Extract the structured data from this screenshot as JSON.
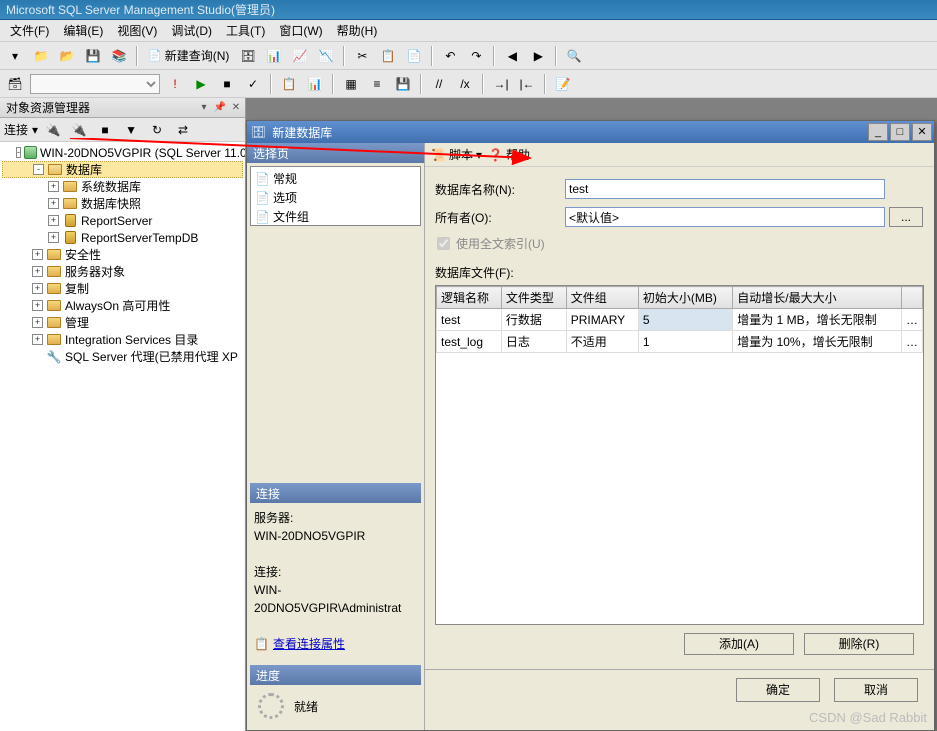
{
  "app_title": "Microsoft SQL Server Management Studio(管理员)",
  "menu": [
    "文件(F)",
    "编辑(E)",
    "视图(V)",
    "调试(D)",
    "工具(T)",
    "窗口(W)",
    "帮助(H)"
  ],
  "toolbar": {
    "new_query": "新建查询(N)"
  },
  "explorer": {
    "title": "对象资源管理器",
    "connect": "连接",
    "server": "WIN-20DNO5VGPIR (SQL Server 11.0",
    "nodes": {
      "databases": "数据库",
      "sys_db": "系统数据库",
      "db_snapshot": "数据库快照",
      "report_server": "ReportServer",
      "report_server_tmp": "ReportServerTempDB",
      "security": "安全性",
      "server_objects": "服务器对象",
      "replication": "复制",
      "alwayson": "AlwaysOn 高可用性",
      "management": "管理",
      "integration": "Integration Services 目录",
      "agent": "SQL Server 代理(已禁用代理 XP"
    }
  },
  "dialog": {
    "title": "新建数据库",
    "select_page": "选择页",
    "pages": [
      "常规",
      "选项",
      "文件组"
    ],
    "script": "脚本",
    "help": "帮助",
    "db_name_label": "数据库名称(N):",
    "db_name_value": "test",
    "owner_label": "所有者(O):",
    "owner_value": "<默认值>",
    "fulltext": "使用全文索引(U)",
    "files_label": "数据库文件(F):",
    "grid": {
      "headers": [
        "逻辑名称",
        "文件类型",
        "文件组",
        "初始大小(MB)",
        "自动增长/最大大小"
      ],
      "rows": [
        {
          "name": "test",
          "ftype": "行数据",
          "fgroup": "PRIMARY",
          "size": "5",
          "growth": "增量为 1 MB，增长无限制"
        },
        {
          "name": "test_log",
          "ftype": "日志",
          "fgroup": "不适用",
          "size": "1",
          "growth": "增量为 10%，增长无限制"
        }
      ]
    },
    "add_btn": "添加(A)",
    "del_btn": "删除(R)",
    "connection_hdr": "连接",
    "server_lbl": "服务器:",
    "server_val": "WIN-20DNO5VGPIR",
    "conn_lbl": "连接:",
    "conn_val": "WIN-20DNO5VGPIR\\Administrat",
    "view_conn": "查看连接属性",
    "progress_hdr": "进度",
    "ready": "就绪",
    "ok": "确定",
    "cancel": "取消"
  },
  "watermark": "CSDN @Sad Rabbit"
}
